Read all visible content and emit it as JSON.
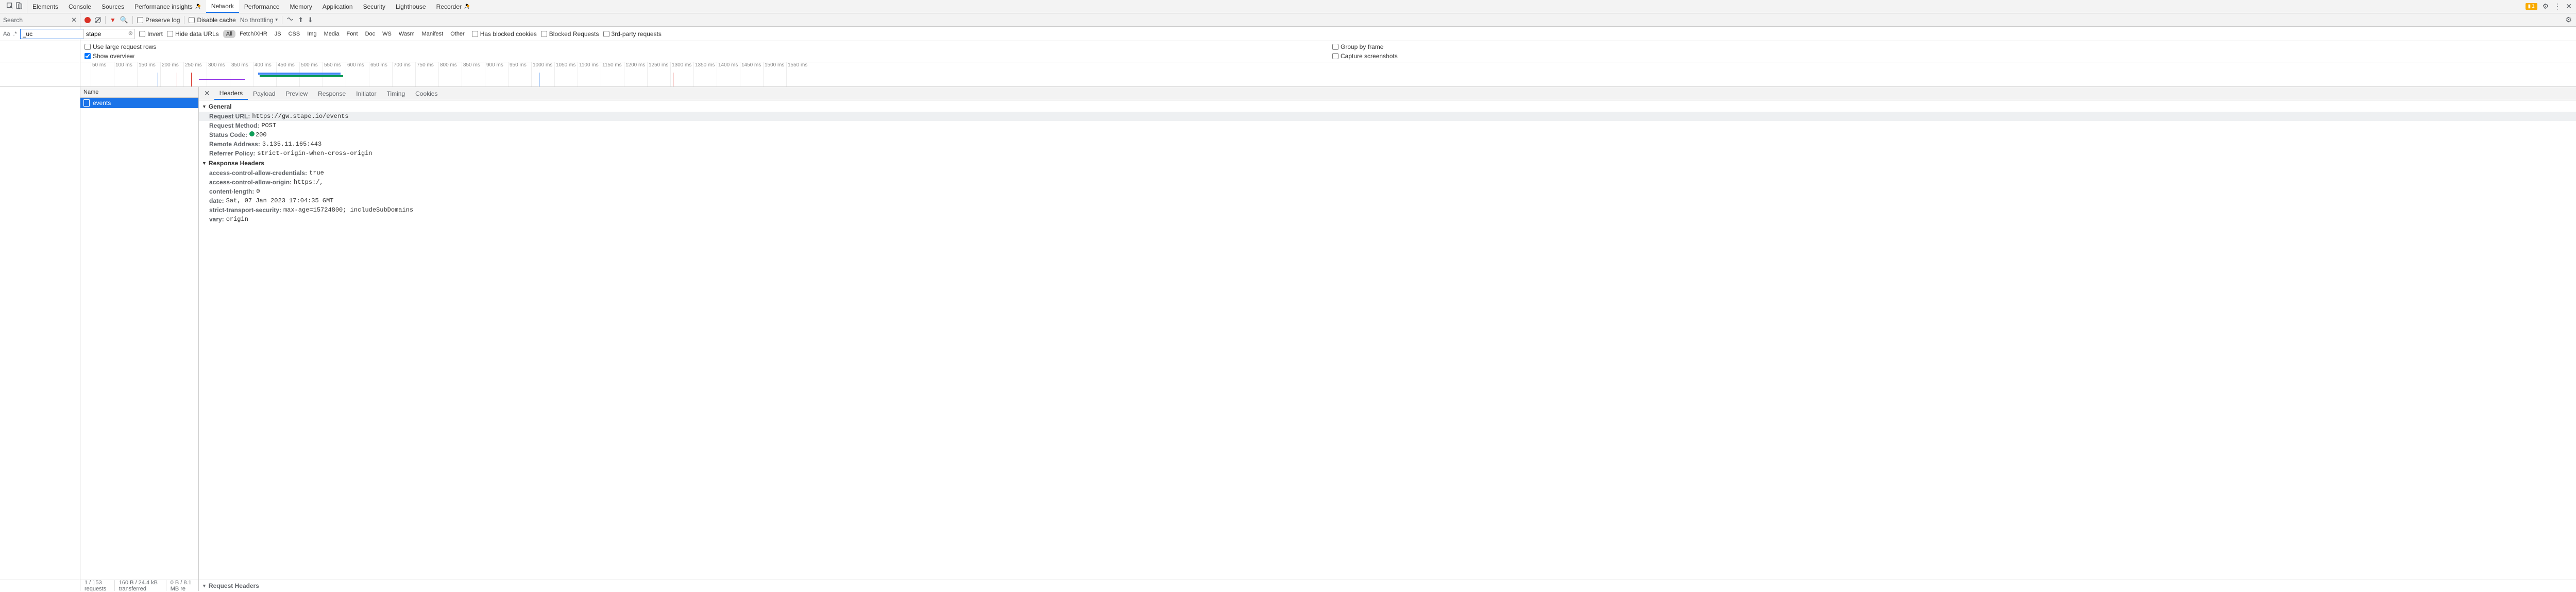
{
  "tabs": {
    "items": [
      "Elements",
      "Console",
      "Sources",
      "Performance insights",
      "Network",
      "Performance",
      "Memory",
      "Application",
      "Security",
      "Lighthouse",
      "Recorder"
    ],
    "active": "Network",
    "beta_indices": [
      3,
      10
    ]
  },
  "issues": {
    "count": "1"
  },
  "toolbar": {
    "search_label": "Search",
    "preserve_log": "Preserve log",
    "disable_cache": "Disable cache",
    "throttling": "No throttling"
  },
  "search_row": {
    "search_value": "_uc",
    "filter_value": "stape",
    "invert": "Invert",
    "hide_data_urls": "Hide data URLs",
    "chips": [
      "All",
      "Fetch/XHR",
      "JS",
      "CSS",
      "Img",
      "Media",
      "Font",
      "Doc",
      "WS",
      "Wasm",
      "Manifest",
      "Other"
    ],
    "active_chip": "All",
    "blocked_cookies": "Has blocked cookies",
    "blocked_requests": "Blocked Requests",
    "third_party": "3rd-party requests"
  },
  "options": {
    "large_rows": "Use large request rows",
    "show_overview": "Show overview",
    "group_by_frame": "Group by frame",
    "capture_screenshots": "Capture screenshots"
  },
  "timeline": {
    "ticks": [
      "50 ms",
      "100 ms",
      "150 ms",
      "200 ms",
      "250 ms",
      "300 ms",
      "350 ms",
      "400 ms",
      "450 ms",
      "500 ms",
      "550 ms",
      "600 ms",
      "650 ms",
      "700 ms",
      "750 ms",
      "800 ms",
      "850 ms",
      "900 ms",
      "950 ms",
      "1000 ms",
      "1050 ms",
      "1100 ms",
      "1150 ms",
      "1200 ms",
      "1250 ms",
      "1300 ms",
      "1350 ms",
      "1400 ms",
      "1450 ms",
      "1500 ms",
      "1550 ms"
    ]
  },
  "name_list": {
    "header": "Name",
    "items": [
      "events"
    ]
  },
  "detail_tabs": {
    "items": [
      "Headers",
      "Payload",
      "Preview",
      "Response",
      "Initiator",
      "Timing",
      "Cookies"
    ],
    "active": "Headers"
  },
  "sections": {
    "general": {
      "title": "General",
      "kv": [
        {
          "k": "Request URL:",
          "v": "https://gw.stape.io/events"
        },
        {
          "k": "Request Method:",
          "v": "POST"
        },
        {
          "k": "Status Code:",
          "v": "200",
          "status": true
        },
        {
          "k": "Remote Address:",
          "v": "3.135.11.165:443"
        },
        {
          "k": "Referrer Policy:",
          "v": "strict-origin-when-cross-origin"
        }
      ]
    },
    "response": {
      "title": "Response Headers",
      "kv": [
        {
          "k": "access-control-allow-credentials:",
          "v": "true"
        },
        {
          "k": "access-control-allow-origin:",
          "v": "https:/,"
        },
        {
          "k": "content-length:",
          "v": "0"
        },
        {
          "k": "date:",
          "v": "Sat, 07 Jan 2023 17:04:35 GMT"
        },
        {
          "k": "strict-transport-security:",
          "v": "max-age=15724800; includeSubDomains"
        },
        {
          "k": "vary:",
          "v": "origin"
        }
      ]
    },
    "request": {
      "title": "Request Headers"
    }
  },
  "status": {
    "requests": "1 / 153 requests",
    "transferred": "160 B / 24.4 kB transferred",
    "resources": "0 B / 8.1 MB re"
  }
}
